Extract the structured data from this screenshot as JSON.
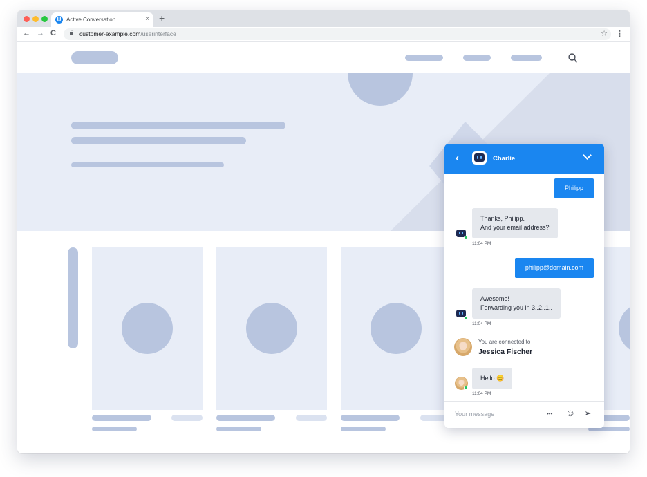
{
  "browser": {
    "tab_title": "Active Conversation",
    "tab_close": "×",
    "new_tab": "+",
    "url_domain": "customer-example.com",
    "url_path": "/userinterface",
    "back": "←",
    "forward": "→",
    "reload": "C",
    "bookmark": "☆",
    "menu": "⋮",
    "favicon_letter": "U"
  },
  "chat": {
    "agent_name": "Charlie",
    "back_icon": "‹",
    "messages": [
      {
        "from": "user",
        "text": "Philipp"
      },
      {
        "from": "bot",
        "lines": [
          "Thanks, Philipp.",
          "And your email address?"
        ],
        "time": "11:04 PM"
      },
      {
        "from": "user",
        "text": "philipp@domain.com"
      },
      {
        "from": "bot",
        "lines": [
          "Awesome!",
          "Forwarding you in 3..2..1.."
        ],
        "time": "11:04 PM"
      }
    ],
    "connected_text": "You are connected to",
    "connected_agent": "Jessica Fischer",
    "human_message": "Hello 😊",
    "human_time": "11:04 PM",
    "composer_placeholder": "Your message",
    "more_icon": "•••",
    "emoji_icon": "☺",
    "send_icon": "➢"
  },
  "colors": {
    "accent": "#1a86f0",
    "placeholder": "#b8c5df",
    "hero_bg": "#e8edf7",
    "online": "#22c55e"
  }
}
